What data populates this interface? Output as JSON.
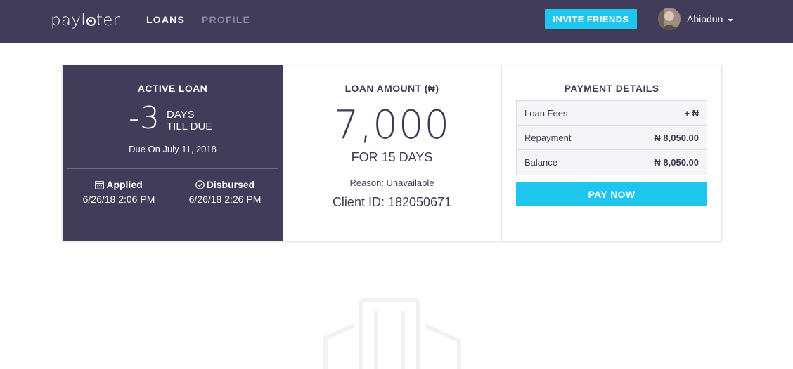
{
  "header": {
    "logo": "paylater",
    "nav": [
      {
        "label": "LOANS",
        "active": true
      },
      {
        "label": "PROFILE",
        "active": false
      }
    ],
    "invite_button": "INVITE FRIENDS",
    "user": {
      "name": "Abiodun",
      "avatar_icon": "user-avatar"
    },
    "colors": {
      "bar": "#403c5a",
      "accent": "#1ec6ee"
    }
  },
  "active_loan": {
    "title": "ACTIVE LOAN",
    "days_value": "-3",
    "days_word": "DAYS",
    "till_due": "TILL DUE",
    "due_on": "Due On July 11, 2018",
    "applied": {
      "label": "Applied",
      "value": "6/26/18 2:06 PM",
      "icon": "calendar-icon"
    },
    "disbursed": {
      "label": "Disbursed",
      "value": "6/26/18 2:26 PM",
      "icon": "check-circle-icon"
    }
  },
  "loan_amount": {
    "title": "LOAN AMOUNT (₦)",
    "amount": "7,000",
    "duration": "FOR 15 DAYS",
    "reason": "Reason: Unavailable",
    "client_id": "Client ID: 182050671"
  },
  "payment_details": {
    "title": "PAYMENT DETAILS",
    "rows": [
      {
        "label": "Loan Fees",
        "value": "+ ₦"
      },
      {
        "label": "Repayment",
        "value": "₦ 8,050.00"
      },
      {
        "label": "Balance",
        "value": "₦ 8,050.00"
      }
    ],
    "pay_button": "PAY NOW"
  }
}
